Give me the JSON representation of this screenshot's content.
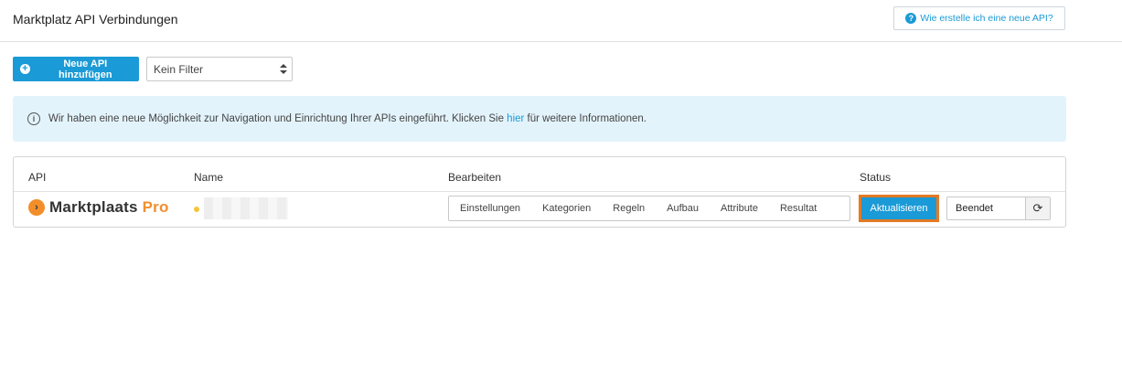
{
  "header": {
    "title": "Marktplatz API Verbindungen",
    "help_label": "Wie erstelle ich eine neue API?",
    "help_icon": "question-circle-icon"
  },
  "toolbar": {
    "add_label": "Neue API hinzufügen",
    "add_icon": "plus-circle-icon",
    "filter_value": "Kein Filter"
  },
  "info": {
    "text_before": "Wir haben eine neue Möglichkeit zur Navigation und Einrichtung Ihrer APIs eingeführt. Klicken Sie ",
    "link": "hier",
    "text_after": " für weitere Informationen."
  },
  "table": {
    "columns": [
      "API",
      "Name",
      "Bearbeiten",
      "Status"
    ],
    "row": {
      "api_logo_main": "Marktplaats",
      "api_logo_pro": "Pro",
      "edit_actions": [
        "Einstellungen",
        "Kategorien",
        "Regeln",
        "Aufbau",
        "Attribute",
        "Resultat"
      ],
      "update_label": "Aktualisieren",
      "status_value": "Beendet",
      "refresh_icon": "refresh-icon"
    }
  },
  "colors": {
    "accent": "#1a9ad6",
    "highlight": "#e47a25",
    "info_bg": "#e3f3fb",
    "logo": "#f28e2b"
  }
}
